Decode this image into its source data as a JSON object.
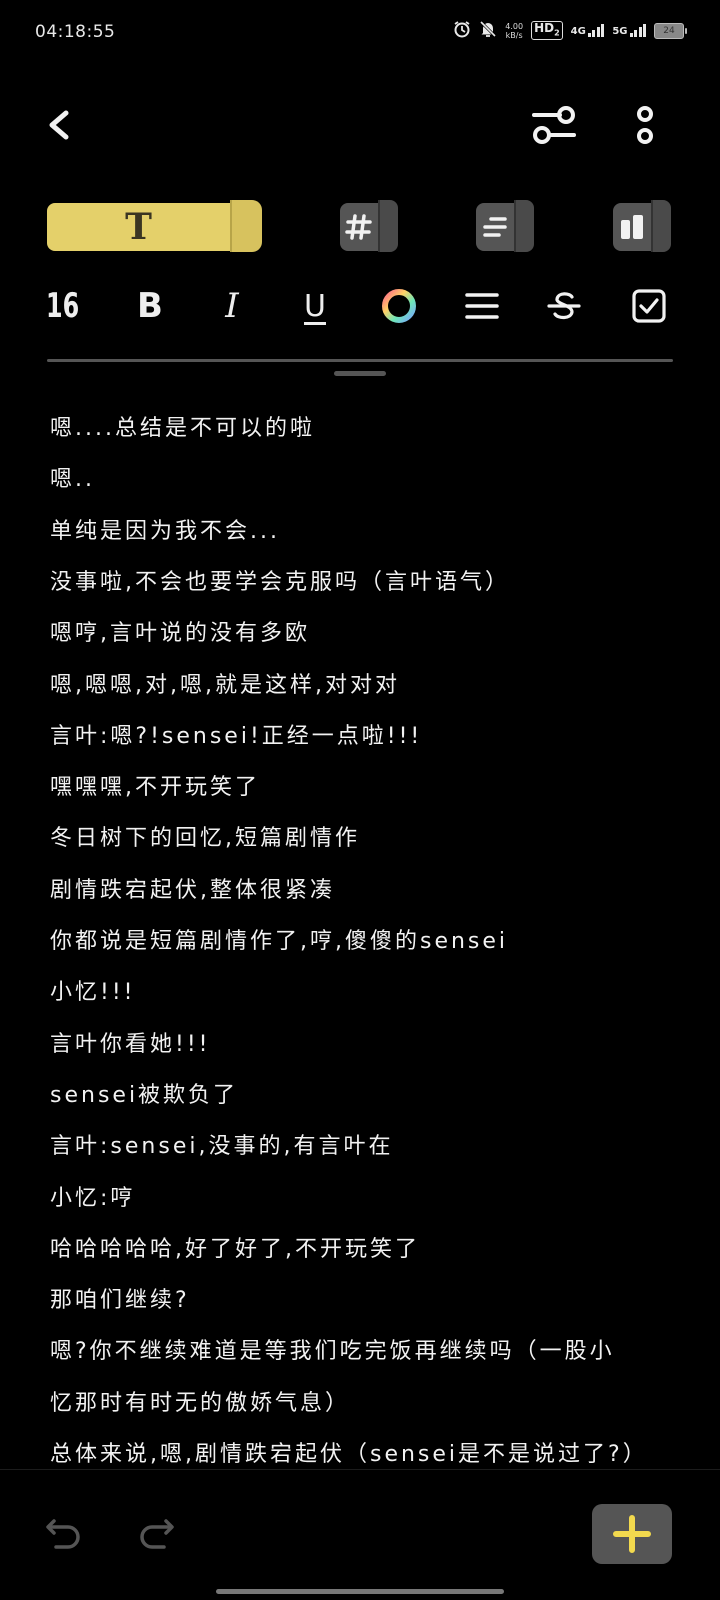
{
  "status_bar": {
    "time": "04:18:55",
    "net_speed_value": "4.00",
    "net_speed_unit": "kB/s",
    "hd_label": "HD",
    "hd_sub": "2",
    "signal1_label": "4G",
    "signal2_label": "5G",
    "battery_level": "24"
  },
  "toolbar": {
    "font_size": "16",
    "bold_label": "B",
    "italic_label": "I",
    "underline_label": "U"
  },
  "mode_tabs": {
    "text_tab_label": "T"
  },
  "colors": {
    "accent_yellow": "#e4d06a",
    "add_plus": "#f2d94e",
    "background": "#000000"
  },
  "content_lines": [
    "嗯....总结是不可以的啦",
    "嗯..",
    "单纯是因为我不会...",
    "没事啦,不会也要学会克服吗（言叶语气）",
    "嗯哼,言叶说的没有多欧",
    "嗯,嗯嗯,对,嗯,就是这样,对对对",
    "言叶:嗯?!sensei!正经一点啦!!!",
    "嘿嘿嘿,不开玩笑了",
    "冬日树下的回忆,短篇剧情作",
    "剧情跌宕起伏,整体很紧凑",
    "你都说是短篇剧情作了,哼,傻傻的sensei",
    "小忆!!!",
    "言叶你看她!!!",
    "sensei被欺负了",
    "言叶:sensei,没事的,有言叶在",
    "小忆:哼",
    "哈哈哈哈哈,好了好了,不开玩笑了",
    "那咱们继续?",
    "嗯?你不继续难道是等我们吃完饭再继续吗（一股小",
    "忆那时有时无的傲娇气息）",
    "总体来说,嗯,剧情跌宕起伏（sensei是不是说过了?）"
  ]
}
